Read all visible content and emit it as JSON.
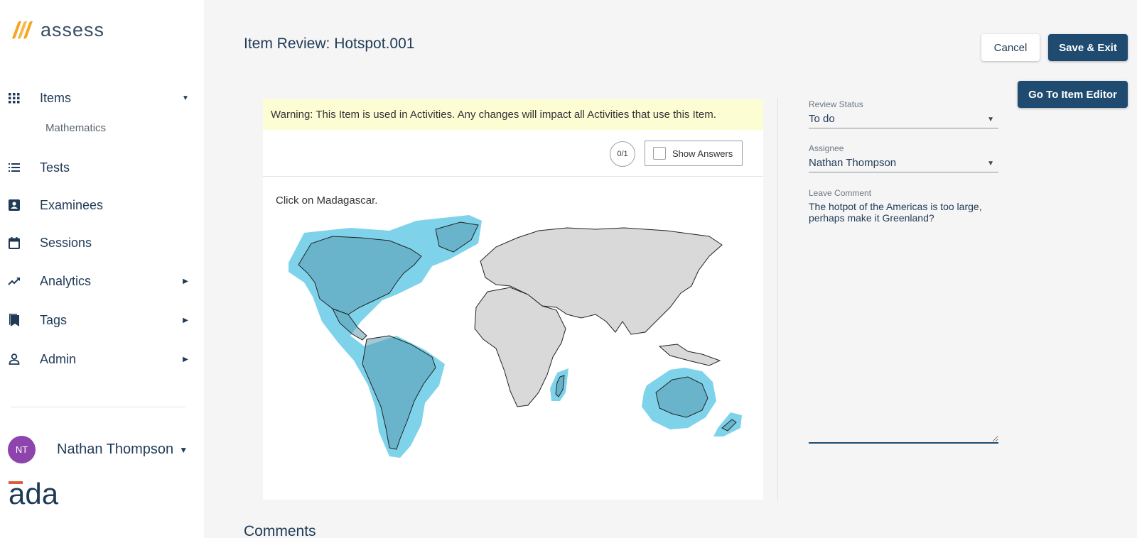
{
  "app": {
    "name": "assess",
    "partner_logo": "ada"
  },
  "colors": {
    "primary": "#1e4b6f",
    "hotspot": "#5ec8e5",
    "warning_bg": "#fdfdd4",
    "avatar": "#8e44ad"
  },
  "sidebar": {
    "items": [
      {
        "label": "Items",
        "icon": "grid-icon",
        "caret": "down"
      },
      {
        "label": "Tests",
        "icon": "list-icon"
      },
      {
        "label": "Examinees",
        "icon": "contact-card-icon"
      },
      {
        "label": "Sessions",
        "icon": "calendar-icon"
      },
      {
        "label": "Analytics",
        "icon": "trending-up-icon",
        "caret": "right"
      },
      {
        "label": "Tags",
        "icon": "bookmarks-icon",
        "caret": "right"
      },
      {
        "label": "Admin",
        "icon": "person-icon",
        "caret": "right"
      }
    ],
    "sub_item": "Mathematics",
    "user": {
      "initials": "NT",
      "name": "Nathan Thompson"
    }
  },
  "header": {
    "title": "Item Review: Hotspot.001",
    "cancel_label": "Cancel",
    "save_label": "Save & Exit",
    "editor_label": "Go To Item Editor"
  },
  "item": {
    "warning": "Warning: This Item is used in Activities. Any changes will impact all Activities that use this Item.",
    "score": "0/1",
    "show_answers_label": "Show Answers",
    "prompt": "Click on Madagascar."
  },
  "review": {
    "status_label": "Review Status",
    "status_value": "To do",
    "assignee_label": "Assignee",
    "assignee_value": "Nathan Thompson",
    "comment_label": "Leave Comment",
    "comment_value": "The hotpot of the Americas is too large, perhaps make it Greenland?"
  },
  "comments_heading": "Comments"
}
